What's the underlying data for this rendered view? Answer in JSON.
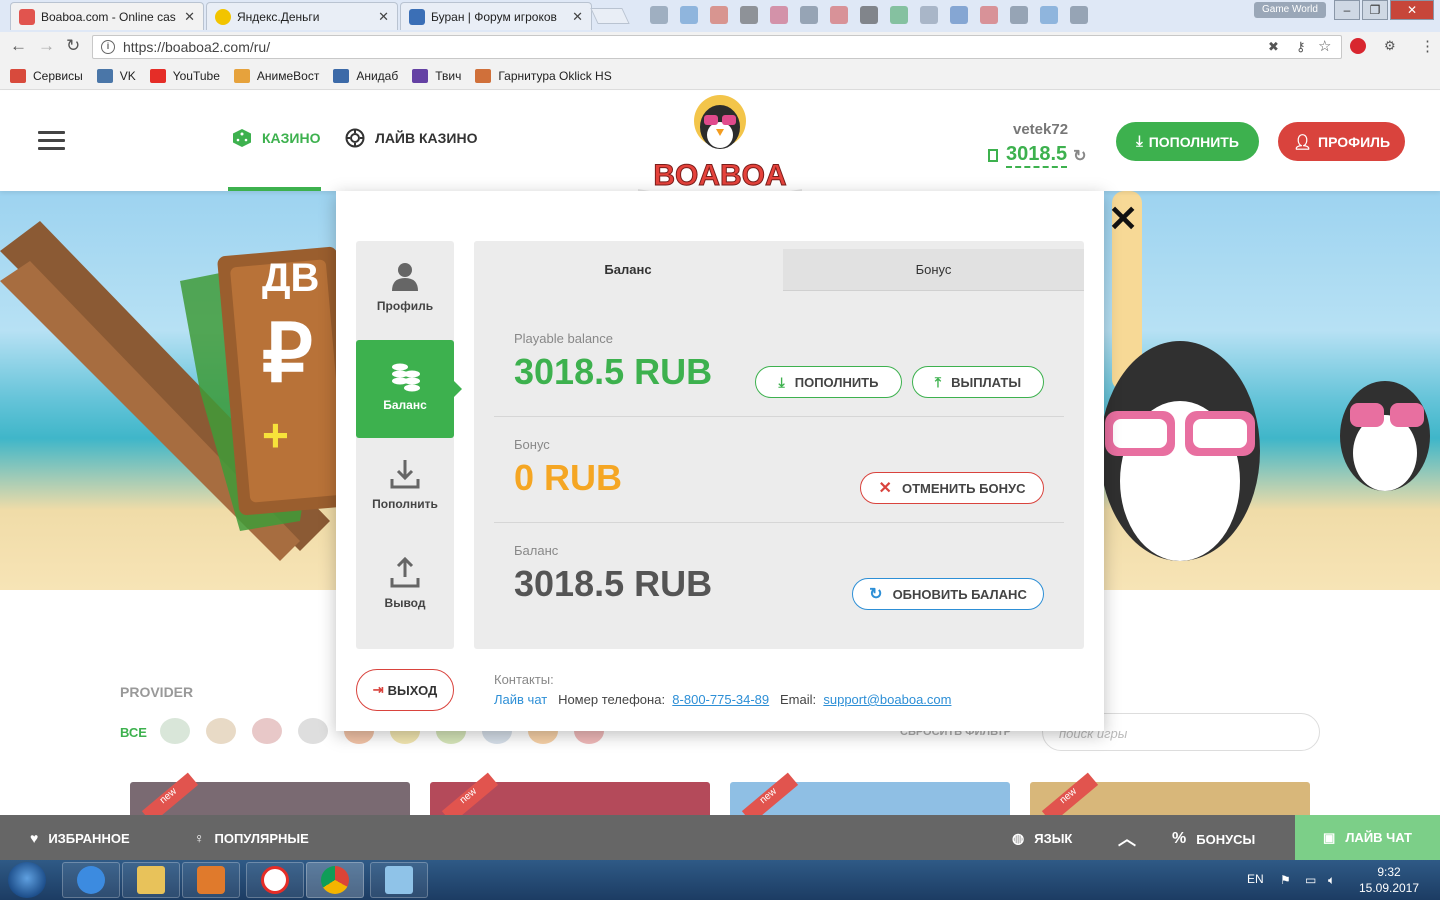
{
  "browser": {
    "tabs": [
      {
        "title": "Boaboa.com - Online cas",
        "color": "#e1544e"
      },
      {
        "title": "Яндекс.Деньги",
        "color": "#f2c400"
      },
      {
        "title": "Буран | Форум игроков",
        "color": "#3b6fb6"
      }
    ],
    "close_glyph": "✕",
    "game_world": "Game World",
    "url": "https://boaboa2.com/ru/",
    "bookmarks": [
      {
        "label": "Сервисы",
        "color": "#d84a3c"
      },
      {
        "label": "VK",
        "color": "#4a76a8"
      },
      {
        "label": "YouTube",
        "color": "#e52d27"
      },
      {
        "label": "АнимеВост",
        "color": "#e6a23c"
      },
      {
        "label": "Анидаб",
        "color": "#3c6aa8"
      },
      {
        "label": "Твич",
        "color": "#6441a4"
      },
      {
        "label": "Гарнитура Oklick HS",
        "color": "#d0703a"
      }
    ]
  },
  "header": {
    "nav": {
      "casino": "КАЗИНО",
      "live_casino": "ЛАЙВ КАЗИНО"
    },
    "logo_text": "BOABOA",
    "username": "vetek72",
    "balance": "3018.5",
    "deposit_label": "ПОПОЛНИТЬ",
    "profile_label": "ПРОФИЛЬ"
  },
  "modal": {
    "side_menu": [
      "Профиль",
      "Баланс",
      "Пополнить",
      "Вывод"
    ],
    "active_item": "Баланс",
    "tabs": {
      "balance": "Баланс",
      "bonus": "Бонус"
    },
    "playable": {
      "label": "Playable balance",
      "amount": "3018.5 RUB",
      "deposit_btn": "ПОПОЛНИТЬ",
      "withdraw_btn": "ВЫПЛАТЫ"
    },
    "bonus": {
      "label": "Бонус",
      "amount": "0 RUB",
      "cancel_btn": "ОТМЕНИТЬ БОНУС"
    },
    "total": {
      "label": "Баланс",
      "amount": "3018.5 RUB",
      "refresh_btn": "ОБНОВИТЬ БАЛАНС"
    },
    "logout_label": "ВЫХОД",
    "contacts": {
      "label": "Контакты:",
      "live_chat": "Лайв чат",
      "phone_label": "Номер телефона:",
      "phone": "8-800-775-34-89",
      "email_label": "Email:",
      "email": "support@boaboa.com"
    }
  },
  "page": {
    "provider_label": "PROVIDER",
    "provider_all": "ВСЕ",
    "reset_filter": "СБРОСИТЬ ФИЛЬТР",
    "search_placeholder": "поиск игры",
    "new_badge": "new"
  },
  "footer": {
    "favorites": "ИЗБРАННОЕ",
    "popular": "ПОПУЛЯРНЫЕ",
    "language": "ЯЗЫК",
    "bonuses": "БОНУСЫ",
    "live_chat": "ЛАЙВ ЧАТ"
  },
  "taskbar": {
    "lang": "EN",
    "time": "9:32",
    "date": "15.09.2017"
  },
  "colors": {
    "accent_green": "#3db14e",
    "accent_red": "#d9433d",
    "bonus_orange": "#f5a623",
    "link_blue": "#2d8fd6"
  }
}
